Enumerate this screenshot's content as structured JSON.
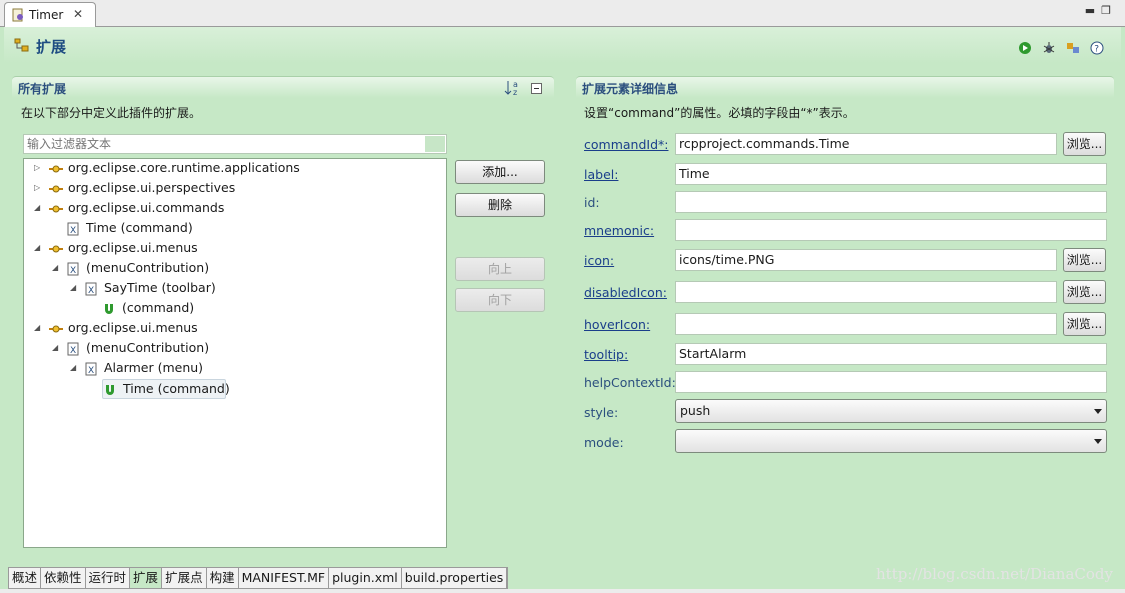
{
  "editor_tab": {
    "title": "Timer",
    "close": "✕"
  },
  "window_controls": {
    "minimize": "▬",
    "maximize": "❐"
  },
  "header": {
    "title": "扩展"
  },
  "left_section": {
    "title": "所有扩展",
    "description": "在以下部分中定义此插件的扩展。",
    "filter_placeholder": "输入过滤器文本",
    "tree": [
      {
        "label": "org.eclipse.core.runtime.applications",
        "toggle": "▷",
        "icon": "extension-point-icon",
        "depth": 0
      },
      {
        "label": "org.eclipse.ui.perspectives",
        "toggle": "▷",
        "icon": "extension-point-icon",
        "depth": 0
      },
      {
        "label": "org.eclipse.ui.commands",
        "toggle": "◢",
        "icon": "extension-point-icon",
        "depth": 0
      },
      {
        "label": "Time (command)",
        "toggle": "",
        "icon": "xml-element-icon",
        "depth": 1
      },
      {
        "label": "org.eclipse.ui.menus",
        "toggle": "◢",
        "icon": "extension-point-icon",
        "depth": 0
      },
      {
        "label": "(menuContribution)",
        "toggle": "◢",
        "icon": "xml-element-icon",
        "depth": 1
      },
      {
        "label": "SayTime (toolbar)",
        "toggle": "◢",
        "icon": "xml-element-icon",
        "depth": 2
      },
      {
        "label": "(command)",
        "toggle": "",
        "icon": "command-icon",
        "depth": 3
      },
      {
        "label": "org.eclipse.ui.menus",
        "toggle": "◢",
        "icon": "extension-point-icon",
        "depth": 0
      },
      {
        "label": "(menuContribution)",
        "toggle": "◢",
        "icon": "xml-element-icon",
        "depth": 1
      },
      {
        "label": "Alarmer (menu)",
        "toggle": "◢",
        "icon": "xml-element-icon",
        "depth": 2
      },
      {
        "label": "Time (command)",
        "toggle": "",
        "icon": "command-icon",
        "depth": 3,
        "selected": true
      }
    ],
    "buttons": {
      "add": "添加...",
      "remove": "删除",
      "up": "向上",
      "down": "向下"
    }
  },
  "right_section": {
    "title": "扩展元素详细信息",
    "description": "设置“command”的属性。必填的字段由“*”表示。",
    "browse_label": "浏览...",
    "fields": [
      {
        "label": "commandId*:",
        "value": "rcpproject.commands.Time",
        "link": true,
        "browse": true
      },
      {
        "label": "label:",
        "value": "Time",
        "link": true,
        "browse": false
      },
      {
        "label": "id:",
        "value": "",
        "link": false,
        "browse": false
      },
      {
        "label": "mnemonic:",
        "value": "",
        "link": true,
        "browse": false
      },
      {
        "label": "icon:",
        "value": "icons/time.PNG",
        "link": true,
        "browse": true
      },
      {
        "label": "disabledIcon:",
        "value": "",
        "link": true,
        "browse": true
      },
      {
        "label": "hoverIcon:",
        "value": "",
        "link": true,
        "browse": true
      },
      {
        "label": "tooltip:",
        "value": "StartAlarm",
        "link": true,
        "browse": false
      },
      {
        "label": "helpContextId:",
        "value": "",
        "link": false,
        "browse": false
      }
    ],
    "combos": [
      {
        "label": "style:",
        "value": "push"
      },
      {
        "label": "mode:",
        "value": ""
      }
    ]
  },
  "bottom_tabs": [
    "概述",
    "依赖性",
    "运行时",
    "扩展",
    "扩展点",
    "构建",
    "MANIFEST.MF",
    "plugin.xml",
    "build.properties"
  ],
  "active_bottom_tab": "扩展",
  "watermark": "http://blog.csdn.net/DianaCody",
  "colors": {
    "background": "#c6e8c6",
    "title": "#1e4c82",
    "link": "#1a3e8a"
  }
}
